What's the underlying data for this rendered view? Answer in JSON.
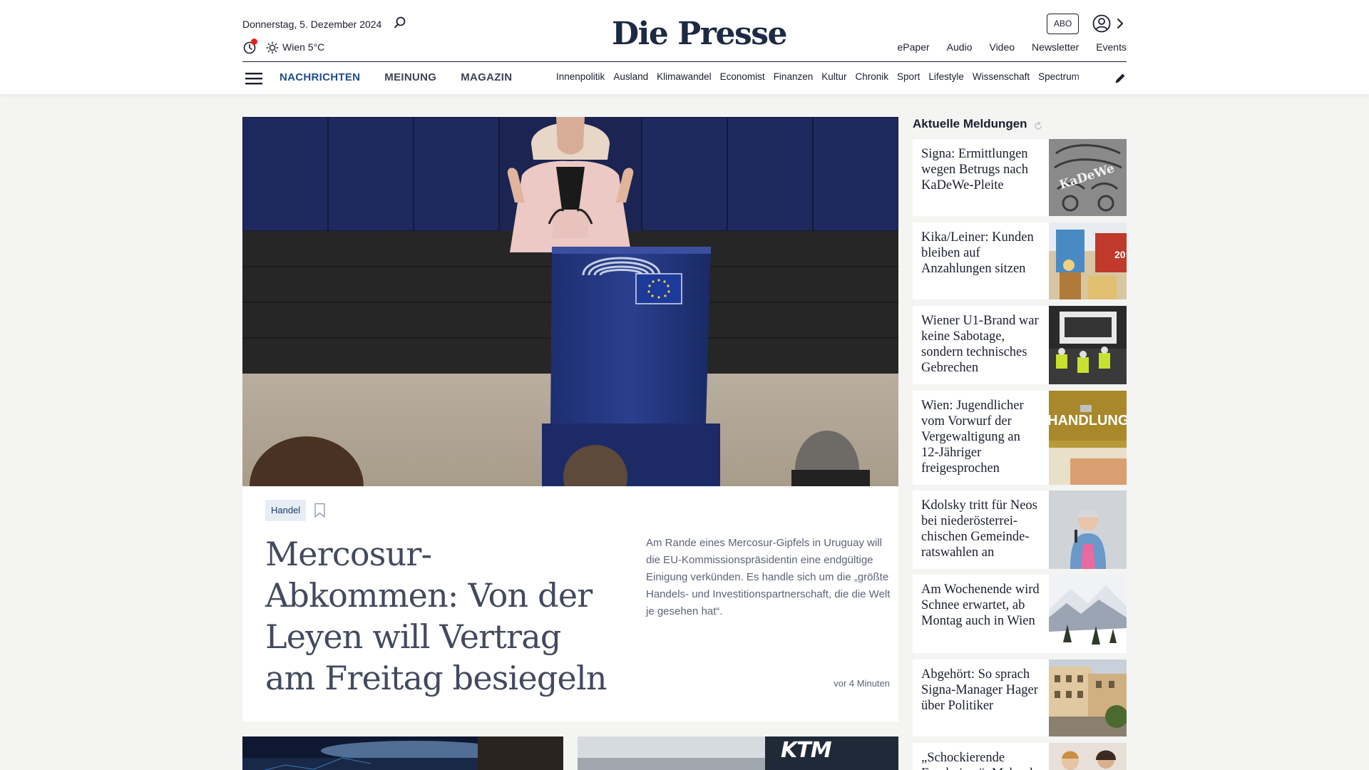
{
  "header": {
    "date": "Donnerstag, 5. Dezember 2024",
    "weather": "Wien 5°C",
    "logo": "Die Presse",
    "abo_label": "ABO",
    "service_links": [
      "ePaper",
      "Audio",
      "Video",
      "Newsletter",
      "Events"
    ]
  },
  "nav": {
    "main": [
      "NACHRICHTEN",
      "MEINUNG",
      "MAGAZIN"
    ],
    "sub": [
      "Innenpolitik",
      "Ausland",
      "Klimawandel",
      "Economist",
      "Finanzen",
      "Kultur",
      "Chronik",
      "Sport",
      "Lifestyle",
      "Wissenschaft",
      "Spectrum"
    ]
  },
  "lead": {
    "topic": "Handel",
    "headline": "Mercosur-Abkommen: Von der Leyen will Vertrag am Freitag besiegeln",
    "teaser": "Am Rande eines Mercosur-Gipfels in Uruguay will die EU-Kommissionspräsidentin eine endgültige Einigung verkünden. Es handle sich um die „größte Handels- und Investitionspartnerschaft, die die Welt je gesehen hat“.",
    "time": "vor 4 Minuten"
  },
  "rail": {
    "title": "Aktuelle Meldungen",
    "items": [
      {
        "title": "Signa: Ermittlungen wegen Betrugs nach KaDeWe-Pleite",
        "thumb_text": "KaDeWe"
      },
      {
        "title": "Kika/Leiner: Kunden bleiben auf Anzahlungen sitzen",
        "thumb_text": "20"
      },
      {
        "title": "Wiener U1-Brand war keine Sabotage, sondern technisches Gebrechen"
      },
      {
        "title": "Wien: Jugendlicher vom Vorwurf der Vergewaltigung an 12-Jähriger freigesprochen",
        "thumb_text": "HANDLUNGSS"
      },
      {
        "title": "Kdolsky tritt für Neos bei niederösterrei-chischen Gemeinde-ratswahlen an"
      },
      {
        "title": "Am Wochenende wird Schnee erwartet, ab Montag auch in Wien"
      },
      {
        "title": "Abgehört: So sprach Signa-Manager Hager über Politiker"
      },
      {
        "title": "„Schockierende Ergebnisse“: Mehr als"
      }
    ]
  },
  "bottom": {
    "ktm_logo": "KTM"
  }
}
